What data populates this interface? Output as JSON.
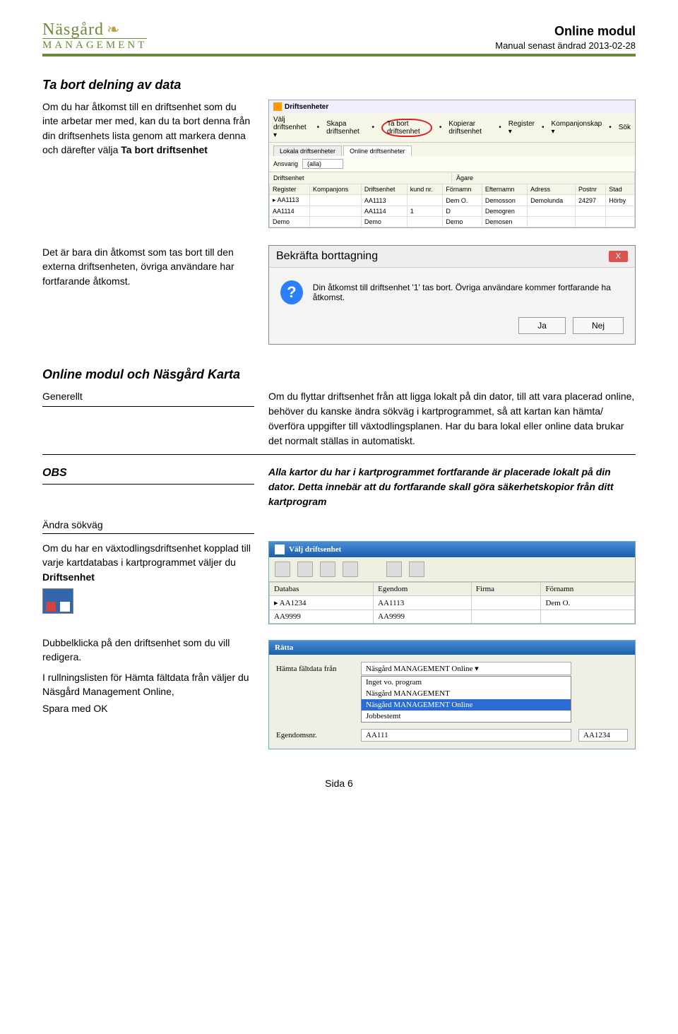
{
  "header": {
    "logo_top": "Näsgård",
    "logo_bottom": "MANAGEMENT",
    "title": "Online modul",
    "subtitle": "Manual senast ändrad 2013-02-28"
  },
  "section1": {
    "title": "Ta bort delning av data",
    "left_text_pre": "Om du har åtkomst till en driftsenhet som du inte arbetar mer med, kan du ta bort denna från din drifts­enhets lista genom att markera denna och därefter välja ",
    "left_text_bold": "Ta bort driftsenhet"
  },
  "table_mock": {
    "window_title": "Driftsenheter",
    "toolbar": [
      "Välj driftsenhet ▾",
      "Skapa driftsenhet",
      "Ta bort driftsenhet",
      "Kopierar driftsenhet",
      "Register ▾",
      "Kompanjonskap ▾",
      "Sök"
    ],
    "tabs": [
      "Lokala driftsenheter",
      "Online driftsenheter"
    ],
    "filter_label": "Ansvarig",
    "filter_value": "(alla)",
    "split_headers": [
      "Driftsenhet",
      "Ägare"
    ],
    "columns": [
      "Register",
      "Kompanjons",
      "Driftsenhet",
      "kund nr.",
      "Förnamn",
      "Efternamn",
      "Adress",
      "Postnr",
      "Stad"
    ],
    "rows": [
      [
        "AA1113",
        "",
        "AA1113",
        "",
        "Dem O.",
        "Demosson",
        "Demolunda",
        "24297",
        "Hörby"
      ],
      [
        "AA1114",
        "",
        "AA1114",
        "1",
        "D",
        "Demogren",
        "",
        "",
        ""
      ],
      [
        "Demo",
        "",
        "Demo",
        "",
        "Demo",
        "Demosen",
        "",
        "",
        ""
      ]
    ]
  },
  "section2": {
    "left_text": "Det är bara din åtkomst som tas bort till den externa driftsenheten, övriga användare har fortfarande åtkomst."
  },
  "dialog": {
    "title": "Bekräfta borttagning",
    "close": "X",
    "body": "Din åtkomst till driftsenhet '1' tas bort. Övriga användare kommer fortfarande ha åtkomst.",
    "yes": "Ja",
    "no": "Nej"
  },
  "section3": {
    "title": "Online modul och Näsgård Karta",
    "generellt_label": "Generellt",
    "generellt_text": "Om du flyttar driftsenhet från att ligga lokalt på din dator, till att vara placerad online, behöver du kanske ändra sökväg i kartprogrammet, så att kartan kan hämta/överföra uppgifter till växtodlingsplanen. Har du bara lokal eller online data brukar det normalt ställas in automatiskt.",
    "obs_label": "OBS",
    "obs_text": "Alla kartor du har i kartprogrammet fortfarande är placerade lokalt på din dator. Detta innebär att du fortfarande skall göra säkerhetskopior från ditt kartprogram",
    "andra_label": "Ändra sökväg",
    "andra_text_pre": "Om du har en växtodlings­driftsenhet kopplad till varje kartdatabas i kartpro­grammet väljer du ",
    "andra_text_bold": "Driftsenhet",
    "bottom_text1": "Dubbelklicka på den driftsenhet som du vill redigera.",
    "bottom_text2": "I rullningslisten för Hämta fältdata från väljer du Näsgård Management Online,",
    "bottom_text3": "Spara med OK"
  },
  "valj_driftsenhet": {
    "title": "Välj driftsenhet",
    "columns": [
      "Databas",
      "Egendom",
      "Firma",
      "Förnamn"
    ],
    "rows": [
      [
        "AA1234",
        "AA1113",
        "",
        "Dem O."
      ],
      [
        "AA9999",
        "AA9999",
        "",
        ""
      ]
    ]
  },
  "ratta": {
    "title": "Rätta",
    "label1": "Hämta fältdata från",
    "field1": "Näsgård MANAGEMENT Online ▾",
    "dropdown": [
      "Inget vo. program",
      "Näsgård MANAGEMENT",
      "Näsgård MANAGEMENT Online",
      "Jobbestemt"
    ],
    "label2": "Egendomsnr.",
    "field2a": "AA111",
    "field2b": "AA1234"
  },
  "footer": "Sida 6"
}
